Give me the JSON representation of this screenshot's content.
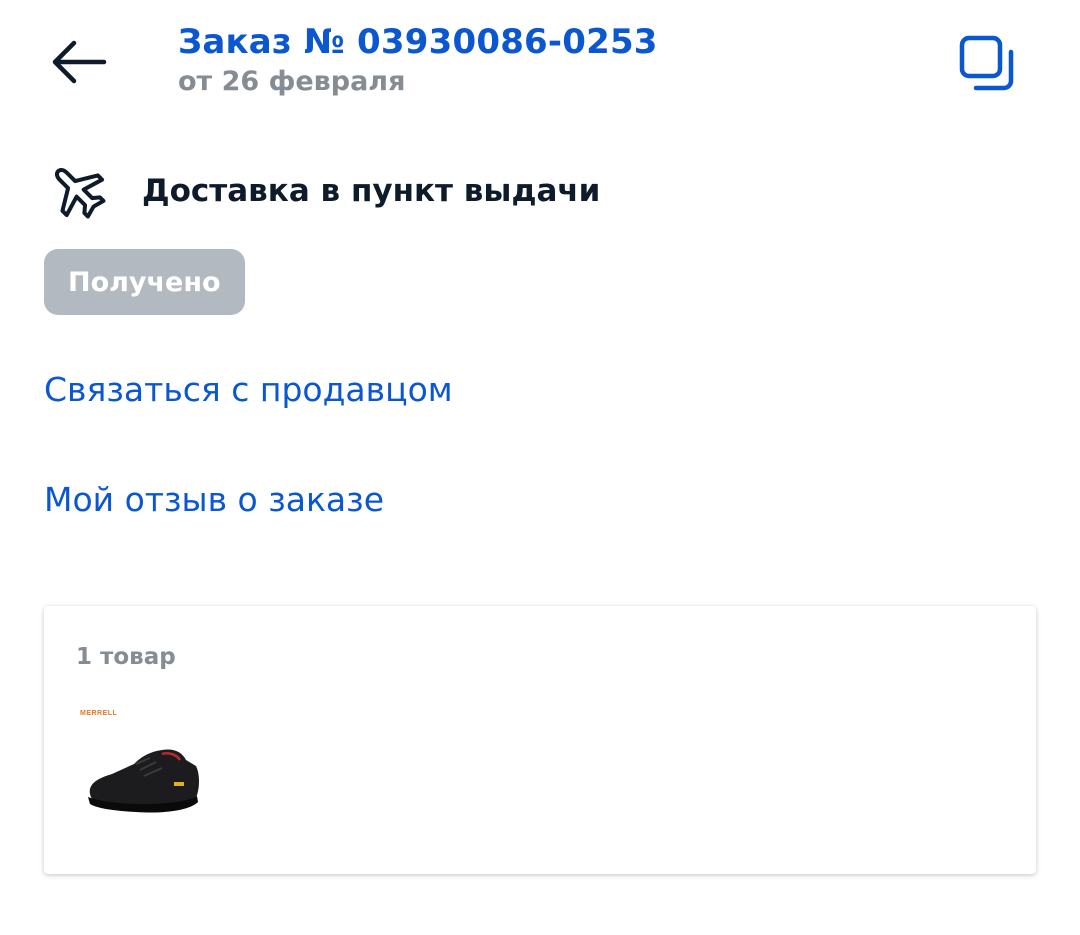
{
  "header": {
    "order_title": "Заказ № 03930086-0253",
    "order_date": "от 26 февраля"
  },
  "delivery": {
    "label": "Доставка в пункт выдачи",
    "icon": "airplane-icon"
  },
  "status": {
    "label": "Получено"
  },
  "links": {
    "contact_seller": "Связаться с продавцом",
    "my_review": "Мой отзыв о заказе"
  },
  "items": {
    "count_label": "1 товар",
    "products": [
      {
        "brand": "MERRELL"
      }
    ]
  },
  "colors": {
    "accent": "#0b57d0",
    "status_bg": "#b3b9c0",
    "muted_text": "#858c94"
  }
}
